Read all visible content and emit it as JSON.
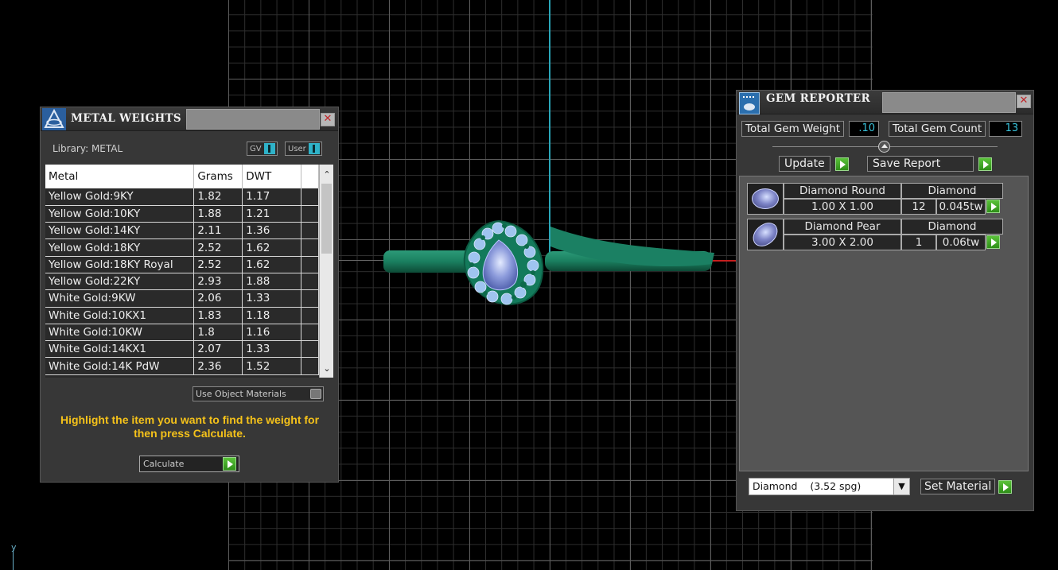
{
  "viewport": {
    "axis_label": "y"
  },
  "metal_weights": {
    "title": "METAL WEIGHTS",
    "library_label": "Library: METAL",
    "toggle_gv": "GV",
    "toggle_user": "User",
    "columns": [
      "Metal",
      "Grams",
      "DWT"
    ],
    "rows": [
      [
        "Yellow Gold:9KY",
        "1.82",
        "1.17"
      ],
      [
        "Yellow Gold:10KY",
        "1.88",
        "1.21"
      ],
      [
        "Yellow Gold:14KY",
        "2.11",
        "1.36"
      ],
      [
        "Yellow Gold:18KY",
        "2.52",
        "1.62"
      ],
      [
        "Yellow Gold:18KY Royal",
        "2.52",
        "1.62"
      ],
      [
        "Yellow Gold:22KY",
        "2.93",
        "1.88"
      ],
      [
        "White Gold:9KW",
        "2.06",
        "1.33"
      ],
      [
        "White Gold:10KX1",
        "1.83",
        "1.18"
      ],
      [
        "White Gold:10KW",
        "1.8",
        "1.16"
      ],
      [
        "White Gold:14KX1",
        "2.07",
        "1.33"
      ],
      [
        "White Gold:14K PdW",
        "2.36",
        "1.52"
      ]
    ],
    "use_object_materials": "Use Object Materials",
    "hint": "Highlight the item you want to find the weight for then press Calculate.",
    "calculate_label": "Calculate"
  },
  "gem_reporter": {
    "title": "GEM REPORTER",
    "total_weight_label": "Total Gem Weight",
    "total_weight_value": ".10",
    "total_count_label": "Total Gem Count",
    "total_count_value": "13",
    "update_label": "Update",
    "save_report_label": "Save Report",
    "gems": [
      {
        "name": "Diamond Round",
        "material": "Diamond",
        "size": "1.00 X 1.00",
        "count": "12",
        "weight": "0.045tw"
      },
      {
        "name": "Diamond Pear",
        "material": "Diamond",
        "size": "3.00 X 2.00",
        "count": "1",
        "weight": "0.06tw"
      }
    ],
    "material_select": "Diamond    (3.52 spg)",
    "set_material_label": "Set Material"
  }
}
